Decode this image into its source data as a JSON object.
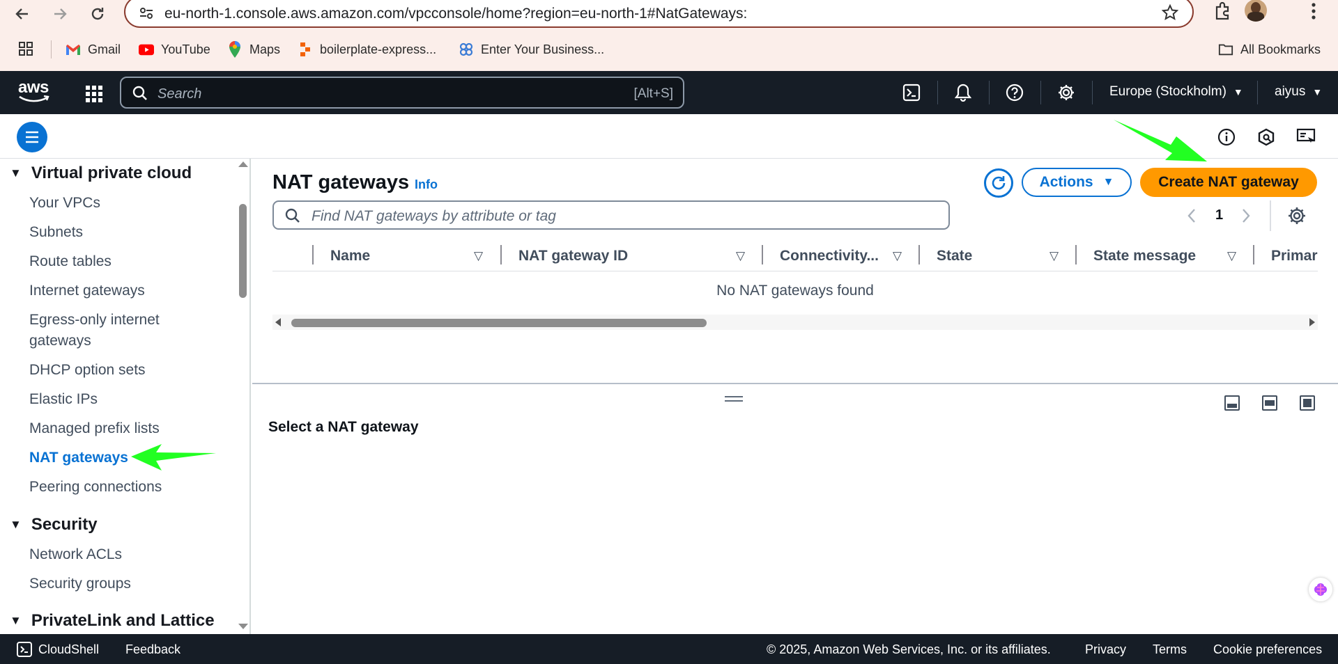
{
  "browser": {
    "url": "eu-north-1.console.aws.amazon.com/vpcconsole/home?region=eu-north-1#NatGateways:",
    "bookmarks": [
      {
        "label": "Gmail",
        "icon": "gmail-icon"
      },
      {
        "label": "YouTube",
        "icon": "youtube-icon"
      },
      {
        "label": "Maps",
        "icon": "maps-icon"
      },
      {
        "label": "boilerplate-express...",
        "icon": "replit-icon"
      },
      {
        "label": "Enter Your Business...",
        "icon": "bubble-icon"
      }
    ],
    "all_bookmarks": "All Bookmarks"
  },
  "aws_nav": {
    "logo": "aws",
    "search_placeholder": "Search",
    "search_shortcut": "[Alt+S]",
    "region": "Europe (Stockholm)",
    "user": "aiyus"
  },
  "sidebar": {
    "sections": [
      {
        "title": "Virtual private cloud"
      },
      {
        "title": "Security"
      },
      {
        "title": "PrivateLink and Lattice"
      }
    ],
    "items": [
      {
        "label": "Your VPCs"
      },
      {
        "label": "Subnets"
      },
      {
        "label": "Route tables"
      },
      {
        "label": "Internet gateways"
      },
      {
        "label": "Egress-only internet gateways"
      },
      {
        "label": "DHCP option sets"
      },
      {
        "label": "Elastic IPs"
      },
      {
        "label": "Managed prefix lists"
      },
      {
        "label": "NAT gateways"
      },
      {
        "label": "Peering connections"
      }
    ],
    "security_items": [
      {
        "label": "Network ACLs"
      },
      {
        "label": "Security groups"
      }
    ]
  },
  "main": {
    "title": "NAT gateways",
    "info": "Info",
    "actions_label": "Actions",
    "create_label": "Create NAT gateway",
    "filter_placeholder": "Find NAT gateways by attribute or tag",
    "page_number": "1",
    "columns": [
      "Name",
      "NAT gateway ID",
      "Connectivity...",
      "State",
      "State message",
      "Primar"
    ],
    "empty_message": "No NAT gateways found",
    "split_title": "Select a NAT gateway"
  },
  "footer": {
    "cloudshell": "CloudShell",
    "feedback": "Feedback",
    "copyright": "© 2025, Amazon Web Services, Inc. or its affiliates.",
    "privacy": "Privacy",
    "terms": "Terms",
    "cookies": "Cookie preferences"
  },
  "colors": {
    "aws_nav_bg": "#161d26",
    "primary_blue": "#0972d3",
    "create_orange": "#ff9900",
    "annotation_green": "#22ff22"
  }
}
